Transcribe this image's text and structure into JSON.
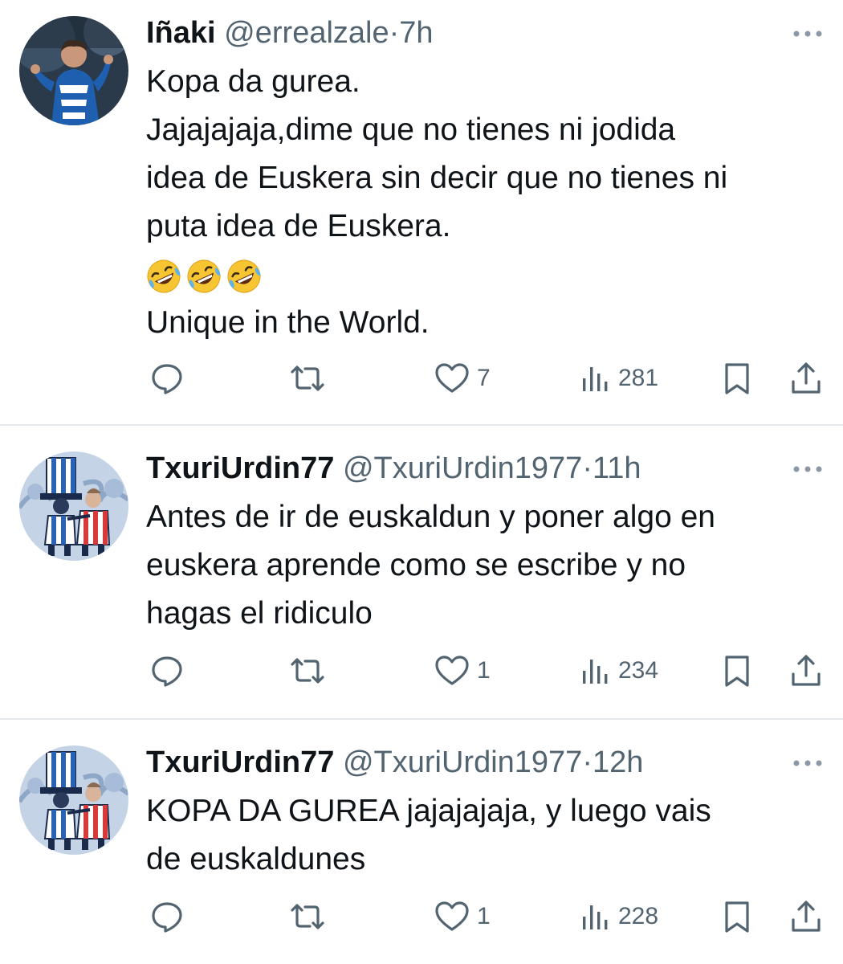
{
  "tweets": [
    {
      "name": "Iñaki",
      "handle": "@errealzale",
      "separator": "·",
      "time": "7h",
      "lines": [
        "Kopa da gurea.",
        "Jajajajaja,dime que no tienes ni jodida",
        "idea de Euskera sin decir que no tienes ni",
        "puta idea de Euskera.",
        "🤣🤣🤣",
        "Unique in the World."
      ],
      "emoji_line": {
        "index": 4,
        "icon": "rolling-on-floor-laughing-emoji",
        "count": 3
      },
      "likes": "7",
      "views": "281"
    },
    {
      "name": "TxuriUrdin77",
      "handle": "@TxuriUrdin1977",
      "separator": "·",
      "time": "11h",
      "lines": [
        "Antes de ir de euskaldun y poner algo en",
        "euskera aprende como se escribe y no",
        "hagas el ridiculo"
      ],
      "likes": "1",
      "views": "234"
    },
    {
      "name": "TxuriUrdin77",
      "handle": "@TxuriUrdin1977",
      "separator": "·",
      "time": "12h",
      "lines": [
        "KOPA DA GUREA jajajajaja, y luego vais",
        "de euskaldunes"
      ],
      "likes": "1",
      "views": "228"
    }
  ],
  "icons": {
    "reply": "reply-icon",
    "retweet": "retweet-icon",
    "like": "heart-icon",
    "views": "views-chart-icon",
    "bookmark": "bookmark-icon",
    "share": "share-icon",
    "more": "more-options-icon"
  },
  "colors": {
    "text": "#0f1419",
    "secondary": "#536471",
    "divider": "#e6e9ec"
  }
}
